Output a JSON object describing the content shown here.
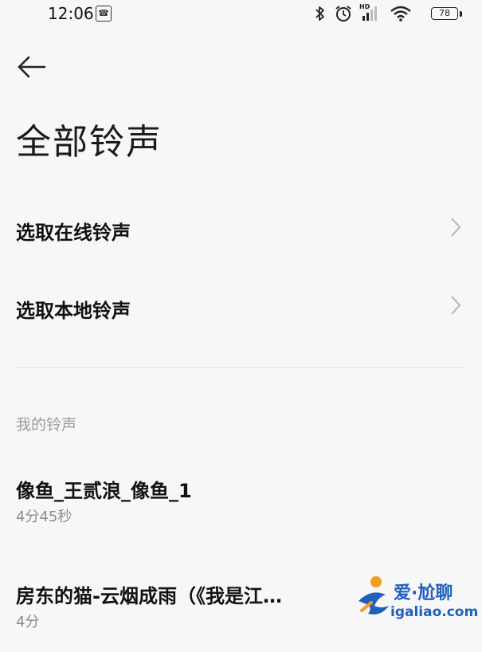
{
  "status_bar": {
    "time": "12:06",
    "battery": "78",
    "network_badge": "HD"
  },
  "header": {
    "title": "全部铃声"
  },
  "options": [
    {
      "label": "选取在线铃声"
    },
    {
      "label": "选取本地铃声"
    }
  ],
  "my_ringtones": {
    "header": "我的铃声",
    "items": [
      {
        "title": "像鱼_王贰浪_像鱼_1",
        "duration": "4分45秒"
      },
      {
        "title": "房东的猫-云烟成雨（《我是江…",
        "duration": "4分"
      }
    ]
  },
  "watermark": {
    "text": "爱·尬聊",
    "url": "igaliao.com"
  },
  "colors": {
    "background": "#f7f7f7",
    "text_primary": "#111111",
    "text_secondary": "#8c8c8c",
    "watermark_blue": "#1f5fbf",
    "watermark_orange": "#f39c1f"
  }
}
